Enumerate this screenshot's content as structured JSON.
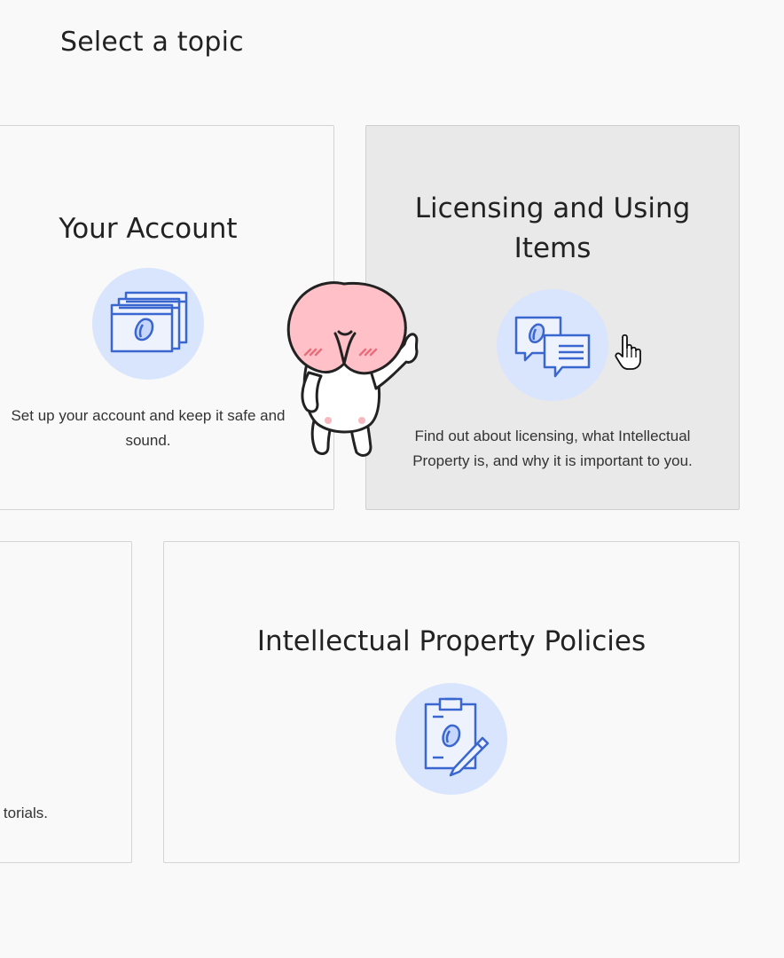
{
  "page": {
    "title": "Select a topic"
  },
  "cards": {
    "account": {
      "title": "Your Account",
      "description": "Set up your account and keep it safe and sound.",
      "icon": "browser-windows-icon"
    },
    "licensing": {
      "title_line1": "Licensing and Using",
      "title_line2": "Items",
      "description_line1": "Find out about licensing, what Intellectual",
      "description_line2": "Property is, and why it is important to you.",
      "icon": "chat-bubbles-icon"
    },
    "tutorials": {
      "description_fragment": "torials."
    },
    "ip_policies": {
      "title": "Intellectual Property Policies",
      "icon": "clipboard-pen-icon"
    }
  },
  "colors": {
    "background": "#f9f9f9",
    "card_hover": "#e9e9e9",
    "icon_circle": "#d9e4fd",
    "icon_stroke": "#3a66d0"
  }
}
